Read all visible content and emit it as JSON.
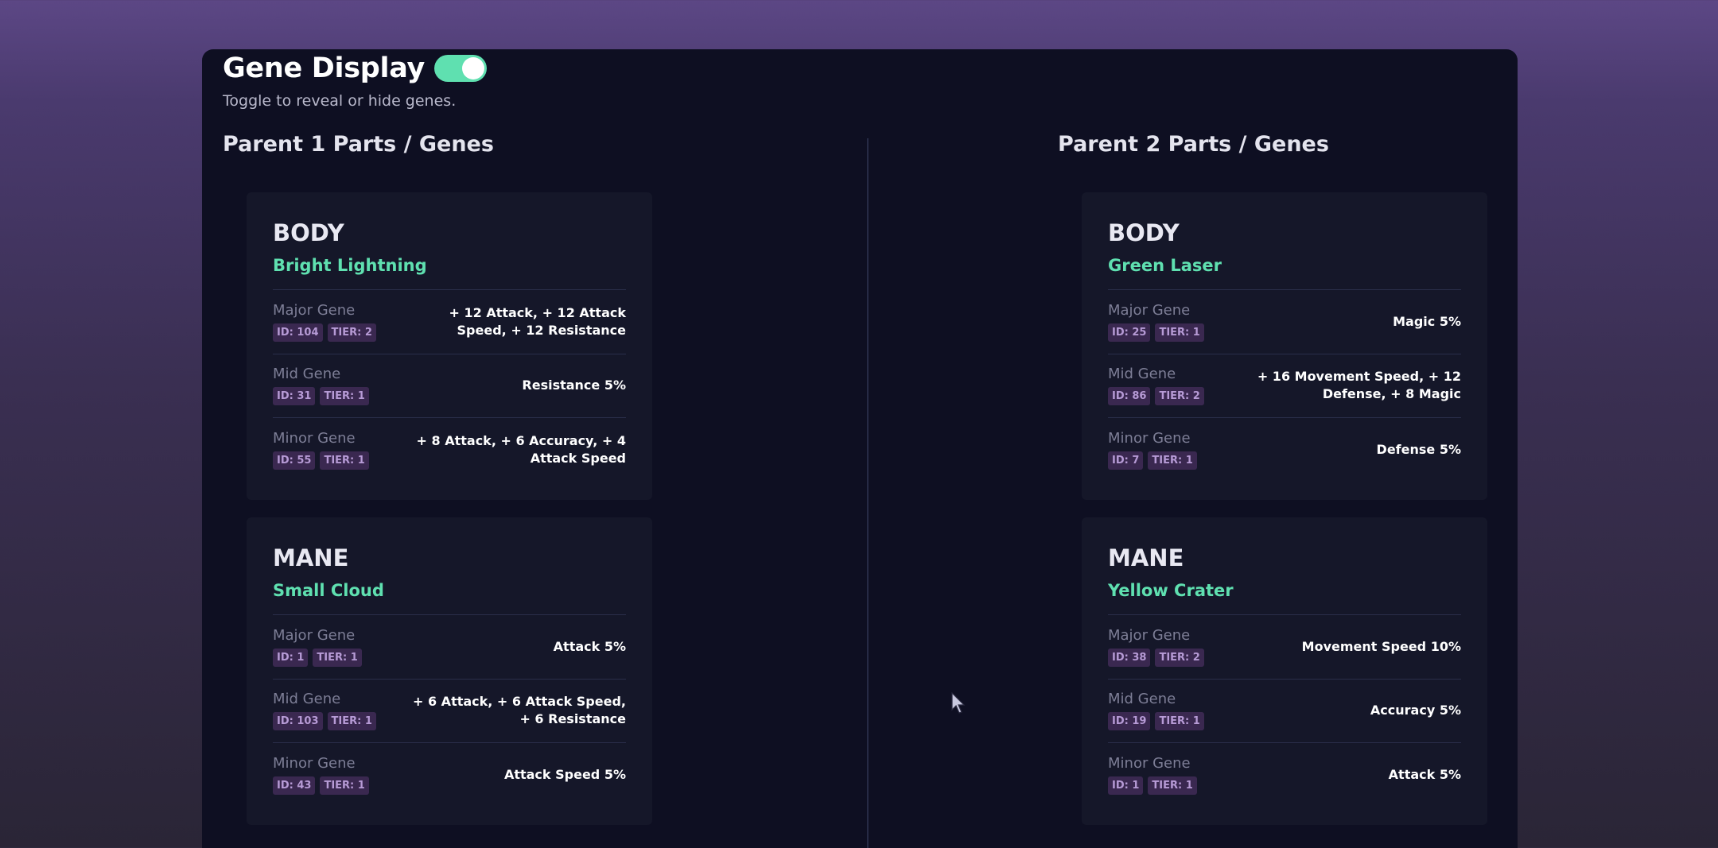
{
  "header": {
    "title": "Gene Display",
    "subtitle": "Toggle to reveal or hide genes.",
    "toggle_on": true
  },
  "parents": [
    {
      "title": "Parent 1 Parts / Genes",
      "parts": [
        {
          "type": "BODY",
          "name": "Bright Lightning",
          "genes": [
            {
              "label": "Major Gene",
              "id": "ID: 104",
              "tier": "TIER: 2",
              "effect": "+ 12 Attack, + 12 Attack Speed, + 12 Resistance"
            },
            {
              "label": "Mid Gene",
              "id": "ID: 31",
              "tier": "TIER: 1",
              "effect": "Resistance 5%"
            },
            {
              "label": "Minor Gene",
              "id": "ID: 55",
              "tier": "TIER: 1",
              "effect": "+ 8 Attack, + 6 Accuracy, + 4 Attack Speed"
            }
          ]
        },
        {
          "type": "MANE",
          "name": "Small Cloud",
          "genes": [
            {
              "label": "Major Gene",
              "id": "ID: 1",
              "tier": "TIER: 1",
              "effect": "Attack 5%"
            },
            {
              "label": "Mid Gene",
              "id": "ID: 103",
              "tier": "TIER: 1",
              "effect": "+ 6 Attack, + 6 Attack Speed, + 6 Resistance"
            },
            {
              "label": "Minor Gene",
              "id": "ID: 43",
              "tier": "TIER: 1",
              "effect": "Attack Speed 5%"
            }
          ]
        }
      ]
    },
    {
      "title": "Parent 2 Parts / Genes",
      "parts": [
        {
          "type": "BODY",
          "name": "Green Laser",
          "genes": [
            {
              "label": "Major Gene",
              "id": "ID: 25",
              "tier": "TIER: 1",
              "effect": "Magic 5%"
            },
            {
              "label": "Mid Gene",
              "id": "ID: 86",
              "tier": "TIER: 2",
              "effect": "+ 16 Movement Speed, + 12 Defense, + 8 Magic"
            },
            {
              "label": "Minor Gene",
              "id": "ID: 7",
              "tier": "TIER: 1",
              "effect": "Defense 5%"
            }
          ]
        },
        {
          "type": "MANE",
          "name": "Yellow Crater",
          "genes": [
            {
              "label": "Major Gene",
              "id": "ID: 38",
              "tier": "TIER: 2",
              "effect": "Movement Speed 10%"
            },
            {
              "label": "Mid Gene",
              "id": "ID: 19",
              "tier": "TIER: 1",
              "effect": "Accuracy 5%"
            },
            {
              "label": "Minor Gene",
              "id": "ID: 1",
              "tier": "TIER: 1",
              "effect": "Attack 5%"
            }
          ]
        }
      ]
    }
  ],
  "colors": {
    "accent": "#5fe0b0",
    "panel": "#0e0f22",
    "card": "#151729",
    "badge_bg": "#3a2850",
    "badge_text": "#b79bd6"
  }
}
